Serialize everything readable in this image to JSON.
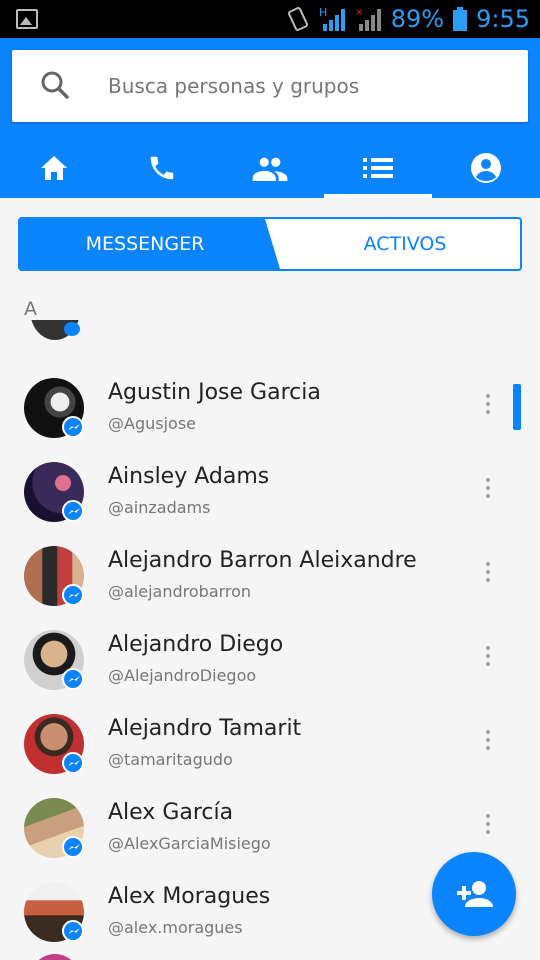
{
  "status_bar": {
    "battery": "89%",
    "time": "9:55",
    "network": "H",
    "icons": [
      "image-icon",
      "vibrate-icon",
      "signal-icon",
      "no-signal-icon",
      "battery-icon"
    ]
  },
  "search": {
    "placeholder": "Busca personas y grupos"
  },
  "nav": {
    "tabs": [
      {
        "icon": "home-icon",
        "active": false
      },
      {
        "icon": "phone-icon",
        "active": false
      },
      {
        "icon": "groups-icon",
        "active": false
      },
      {
        "icon": "list-icon",
        "active": true
      },
      {
        "icon": "profile-icon",
        "active": false
      }
    ]
  },
  "segment": {
    "messenger_label": "MESSENGER",
    "activos_label": "ACTIVOS",
    "selected": "MESSENGER"
  },
  "section_letter": "A",
  "contacts": [
    {
      "name": "Agustin Jose Garcia",
      "handle": "@Agusjose"
    },
    {
      "name": "Ainsley Adams",
      "handle": "@ainzadams"
    },
    {
      "name": "Alejandro Barron Aleixandre",
      "handle": "@alejandrobarron"
    },
    {
      "name": "Alejandro Diego",
      "handle": "@AlejandroDiegoo"
    },
    {
      "name": "Alejandro Tamarit",
      "handle": "@tamaritagudo"
    },
    {
      "name": "Alex García",
      "handle": "@AlexGarciaMisiego"
    },
    {
      "name": "Alex Moragues",
      "handle": "@alex.moragues"
    }
  ],
  "fab": {
    "icon": "add-person-icon"
  },
  "colors": {
    "brand": "#0a84ff",
    "status_text": "#2a9df4"
  }
}
